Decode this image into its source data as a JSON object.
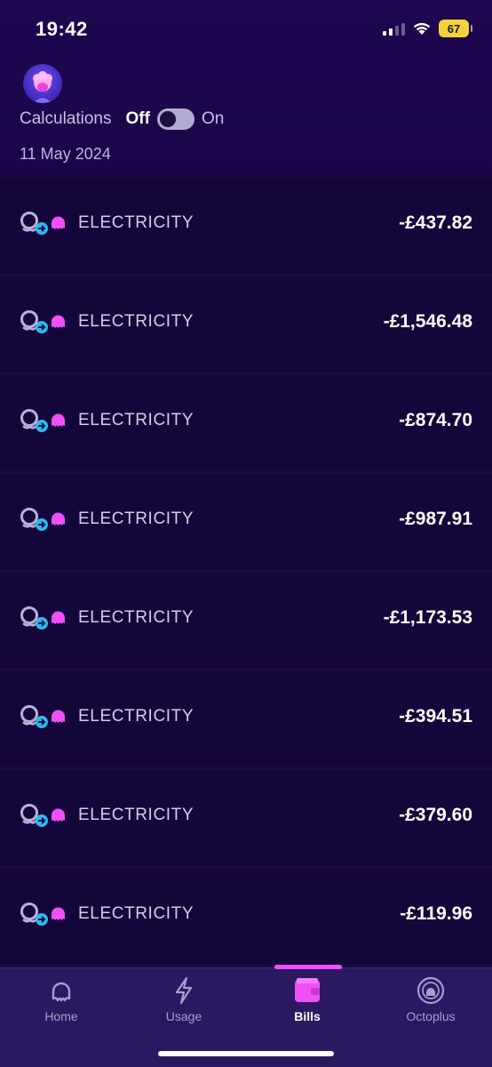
{
  "status_bar": {
    "time": "19:42",
    "battery": "67"
  },
  "header": {
    "calculations_label": "Calculations",
    "toggle_off_label": "Off",
    "toggle_on_label": "On",
    "toggle_state": "off",
    "date": "11 May 2024"
  },
  "bills": [
    {
      "type": "ELECTRICITY",
      "amount": "-£437.82"
    },
    {
      "type": "ELECTRICITY",
      "amount": "-£1,546.48"
    },
    {
      "type": "ELECTRICITY",
      "amount": "-£874.70"
    },
    {
      "type": "ELECTRICITY",
      "amount": "-£987.91"
    },
    {
      "type": "ELECTRICITY",
      "amount": "-£1,173.53"
    },
    {
      "type": "ELECTRICITY",
      "amount": "-£394.51"
    },
    {
      "type": "ELECTRICITY",
      "amount": "-£379.60"
    },
    {
      "type": "ELECTRICITY",
      "amount": "-£119.96"
    }
  ],
  "tabs": [
    {
      "label": "Home",
      "icon": "octopus-icon",
      "active": false
    },
    {
      "label": "Usage",
      "icon": "lightning-icon",
      "active": false
    },
    {
      "label": "Bills",
      "icon": "wallet-icon",
      "active": true
    },
    {
      "label": "Octoplus",
      "icon": "octoplus-icon",
      "active": false
    }
  ],
  "colors": {
    "background": "#140634",
    "header": "#1f0650",
    "accent_pink": "#f050f8",
    "accent_blue": "#2fb8f0",
    "tabbar": "#2a1960"
  }
}
